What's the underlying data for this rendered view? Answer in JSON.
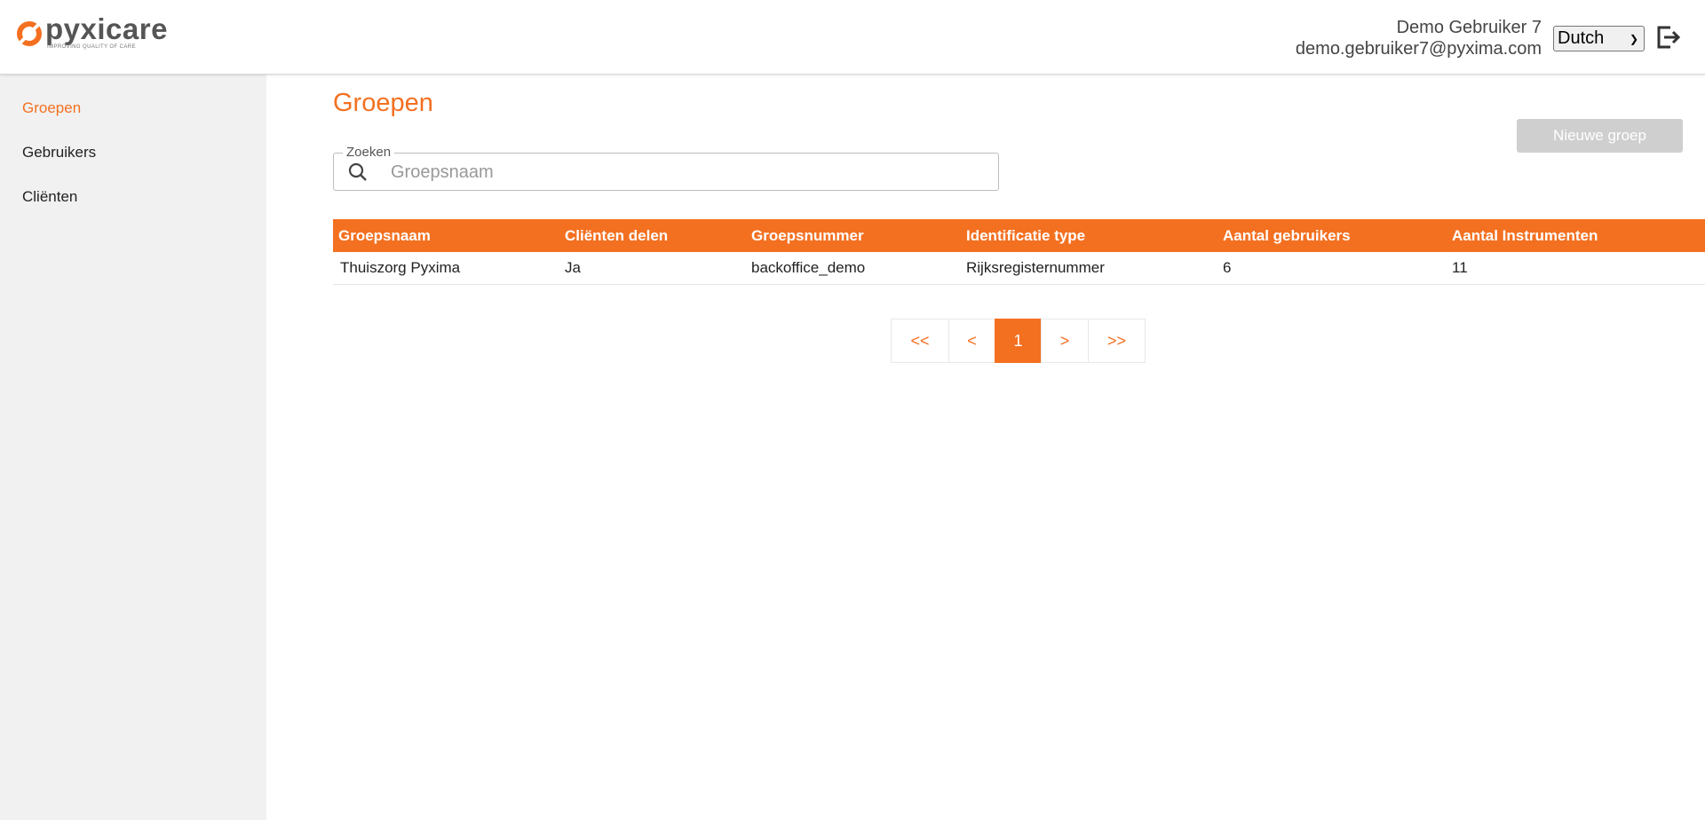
{
  "app": {
    "logo_text": "pyxicare",
    "logo_tagline": "IMPROVING QUALITY OF CARE",
    "brand_color": "#f47021"
  },
  "header": {
    "user_name": "Demo Gebruiker 7",
    "user_email": "demo.gebruiker7@pyxima.com",
    "language": "Dutch",
    "logout_icon": "logout-icon"
  },
  "sidebar": {
    "items": [
      {
        "label": "Groepen",
        "active": true
      },
      {
        "label": "Gebruikers",
        "active": false
      },
      {
        "label": "Cliënten",
        "active": false
      }
    ]
  },
  "main": {
    "title": "Groepen",
    "new_button": "Nieuwe groep",
    "search": {
      "legend": "Zoeken",
      "placeholder": "Groepsnaam",
      "value": ""
    },
    "table": {
      "columns": [
        "Groepsnaam",
        "Cliënten delen",
        "Groepsnummer",
        "Identificatie type",
        "Aantal gebruikers",
        "Aantal Instrumenten"
      ],
      "rows": [
        [
          "Thuiszorg Pyxima",
          "Ja",
          "backoffice_demo",
          "Rijksregisternummer",
          "6",
          "11"
        ]
      ]
    },
    "pagination": {
      "first": "<<",
      "prev": "<",
      "current": "1",
      "next": ">",
      "last": ">>"
    }
  }
}
